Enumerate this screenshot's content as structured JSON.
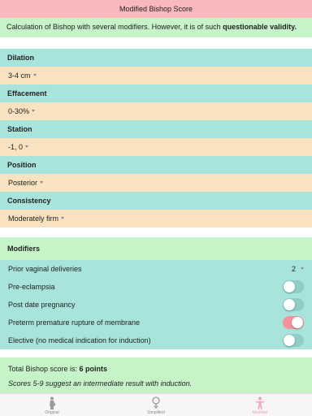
{
  "title": "Modified Bishop Score",
  "intro": {
    "text": "Calculation of Bishop with several modifiers. However, it is of such ",
    "bold": "questionable validity."
  },
  "sections": [
    {
      "header": "Dilation",
      "value": "3-4 cm"
    },
    {
      "header": "Effacement",
      "value": "0-30%"
    },
    {
      "header": "Station",
      "value": "-1, 0"
    },
    {
      "header": "Position",
      "value": "Posterior"
    },
    {
      "header": "Consistency",
      "value": "Moderately firm"
    }
  ],
  "modifiers": {
    "header": "Modifiers",
    "prior_deliveries": {
      "label": "Prior vaginal deliveries",
      "value": "2"
    },
    "toggles": [
      {
        "label": "Pre-eclampsia",
        "on": false
      },
      {
        "label": "Post date pregnancy",
        "on": false
      },
      {
        "label": "Preterm premature rupture of membrane",
        "on": true
      },
      {
        "label": "Elective (no medical indication for induction)",
        "on": false
      }
    ]
  },
  "result": {
    "prefix": "Total Bishop score is: ",
    "score": "6 points",
    "note": "Scores 5-9 suggest an intermediate result with induction."
  },
  "tabs": [
    {
      "label": "Original",
      "icon": "pregnant-person-icon",
      "active": false
    },
    {
      "label": "Simplified",
      "icon": "female-symbol-icon",
      "active": false
    },
    {
      "label": "Modified",
      "icon": "person-icon",
      "active": true
    }
  ],
  "colors": {
    "title_bar": "#f8b8bc",
    "green": "#c6f3c8",
    "teal": "#a8e4dc",
    "peach": "#f8e2bf",
    "toggle_on": "#f4929b",
    "active_tab": "#f4a0c0"
  }
}
